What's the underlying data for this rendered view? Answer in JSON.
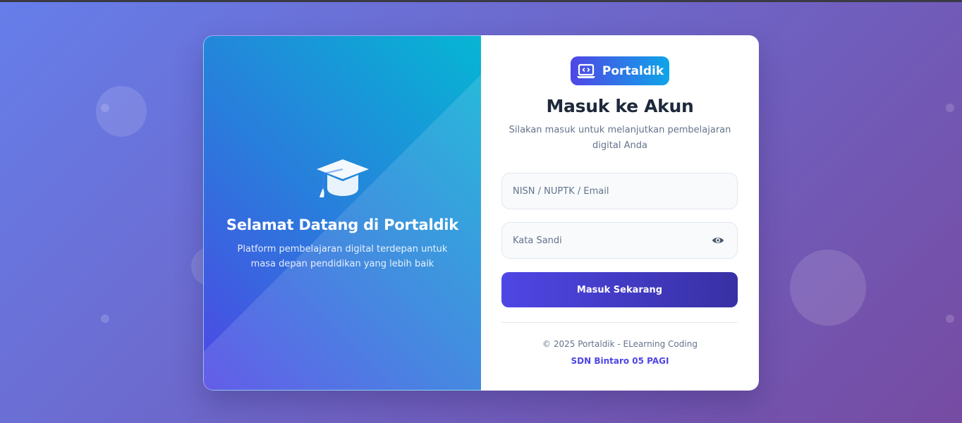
{
  "welcome": {
    "title": "Selamat Datang di Portaldik",
    "subtitle": "Platform pembelajaran digital terdepan untuk masa depan pendidikan yang lebih baik",
    "icon": "graduation-cap-icon"
  },
  "brand": {
    "name": "Portaldik",
    "icon": "laptop-code-icon"
  },
  "login": {
    "title": "Masuk ke Akun",
    "subtitle": "Silakan masuk untuk melanjutkan pembelajaran digital Anda",
    "username_placeholder": "NISN / NUPTK / Email",
    "username_value": "",
    "password_placeholder": "Kata Sandi",
    "password_value": "",
    "submit_label": "Masuk Sekarang"
  },
  "footer": {
    "copyright": "© 2025 Portaldik - ELearning Coding",
    "school": "SDN Bintaro 05 PAGI"
  },
  "colors": {
    "accent": "#4f46e5",
    "accent_dark": "#3730a3",
    "cyan": "#06b6d4",
    "title_text": "#1e293b",
    "muted_text": "#64748b"
  }
}
